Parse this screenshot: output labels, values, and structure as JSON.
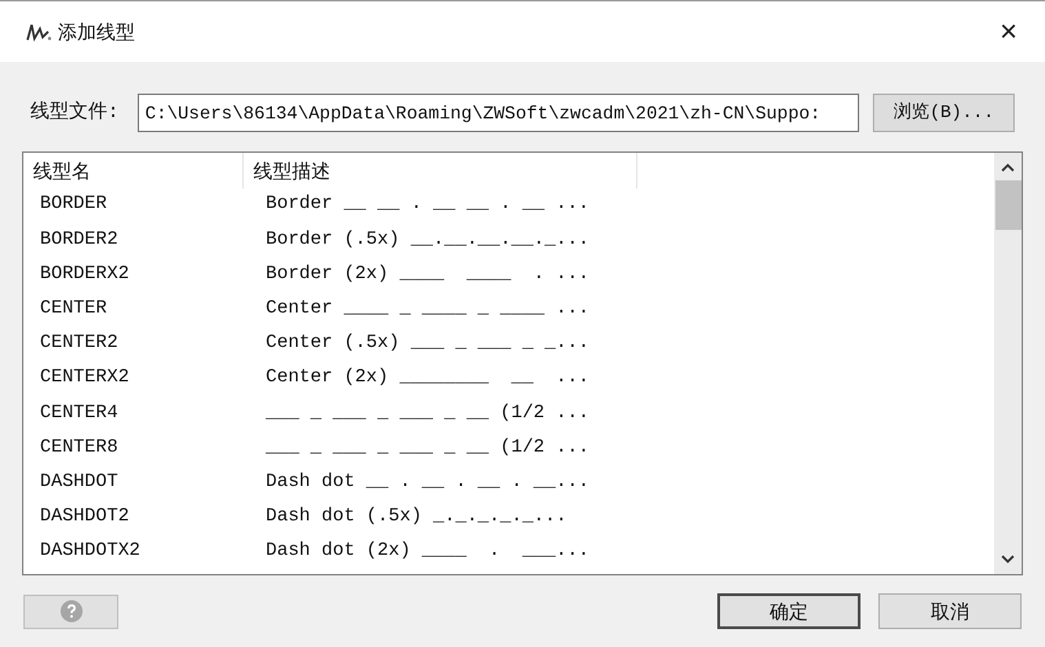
{
  "window": {
    "title": "添加线型",
    "close": "×"
  },
  "file": {
    "label": "线型文件:",
    "value": "C:\\Users\\86134\\AppData\\Roaming\\ZWSoft\\zwcadm\\2021\\zh-CN\\Suppo:",
    "browse": "浏览(B)..."
  },
  "table": {
    "columns": [
      "线型名",
      "线型描述"
    ],
    "rows": [
      {
        "name": "BORDER",
        "description": "Border __ __ . __ __ . __ ..."
      },
      {
        "name": "BORDER2",
        "description": "Border (.5x) __.__.__.__._..."
      },
      {
        "name": "BORDERX2",
        "description": "Border (2x) ____  ____  . ..."
      },
      {
        "name": "CENTER",
        "description": "Center ____ _ ____ _ ____ ..."
      },
      {
        "name": "CENTER2",
        "description": "Center (.5x) ___ _ ___ _ _..."
      },
      {
        "name": "CENTERX2",
        "description": "Center (2x) ________  __  ..."
      },
      {
        "name": "CENTER4",
        "description": "___ _ ___ _ ___ _ __ (1/2 ..."
      },
      {
        "name": "CENTER8",
        "description": "___ _ ___ _ ___ _ __ (1/2 ..."
      },
      {
        "name": "DASHDOT",
        "description": "Dash dot __ . __ . __ . __..."
      },
      {
        "name": "DASHDOT2",
        "description": "Dash dot (.5x) _._._._._..."
      },
      {
        "name": "DASHDOTX2",
        "description": "Dash dot (2x) ____  .  ___..."
      }
    ]
  },
  "help_button": {
    "disabled": true
  },
  "buttons": [
    {
      "label": "确定",
      "default": true
    },
    {
      "label": "取消",
      "default": false
    }
  ]
}
